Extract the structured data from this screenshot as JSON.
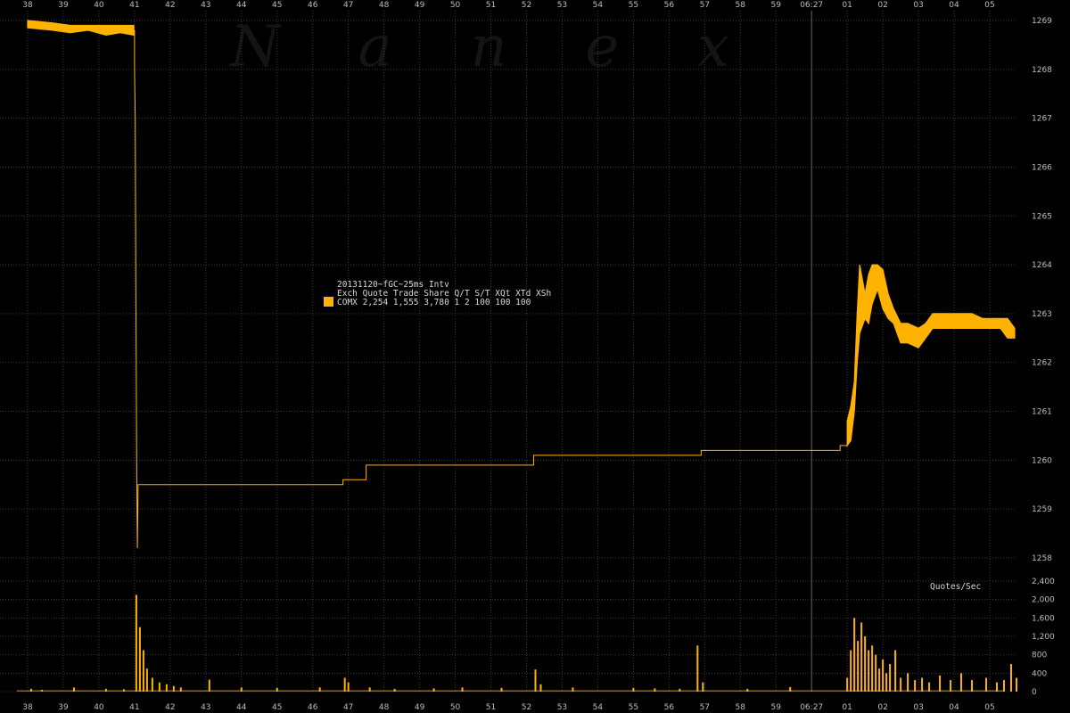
{
  "chart_data": [
    {
      "type": "line",
      "title": "",
      "xlabel": "",
      "ylabel": "",
      "watermark": "N a n e x",
      "grid": true,
      "colors": {
        "background": "#000000",
        "series": "#ffb300",
        "grid": "#3a3a3a",
        "marker_line": "#666666"
      },
      "x_ticks": [
        "38",
        "39",
        "40",
        "41",
        "42",
        "43",
        "44",
        "45",
        "46",
        "47",
        "48",
        "49",
        "50",
        "51",
        "52",
        "53",
        "54",
        "55",
        "56",
        "57",
        "58",
        "59",
        "06:27",
        "01",
        "02",
        "03",
        "04",
        "05"
      ],
      "y_ticks": [
        "1269",
        "1268",
        "1267",
        "1266",
        "1265",
        "1264",
        "1263",
        "1262",
        "1261",
        "1260",
        "1259",
        "1258"
      ],
      "ylim": [
        1257.8,
        1269.2
      ],
      "time_marker": "06:27",
      "legend": {
        "title": "20131120~fGC~25ms Intv",
        "header": "Exch Quote Trade Share  Q/T   S/T  XQt XTd XSh",
        "row": "COMX 2,254 1,555 3,780    1     2 100 100 100"
      },
      "series": [
        {
          "style": "band",
          "points": [
            [
              38.0,
              1268.85,
              1269.0
            ],
            [
              38.7,
              1268.8,
              1268.95
            ],
            [
              39.2,
              1268.75,
              1268.9
            ],
            [
              39.7,
              1268.8,
              1268.9
            ],
            [
              40.2,
              1268.7,
              1268.9
            ],
            [
              40.6,
              1268.75,
              1268.9
            ],
            [
              40.98,
              1268.7,
              1268.9
            ]
          ]
        },
        {
          "style": "line",
          "points": [
            [
              41.0,
              1268.8
            ],
            [
              41.0,
              1268.0
            ],
            [
              41.02,
              1267.0
            ],
            [
              41.03,
              1265.0
            ],
            [
              41.04,
              1263.0
            ],
            [
              41.05,
              1261.6
            ],
            [
              41.06,
              1260.0
            ],
            [
              41.07,
              1259.0
            ],
            [
              41.08,
              1258.2
            ],
            [
              41.1,
              1259.5
            ],
            [
              46.85,
              1259.5
            ],
            [
              46.85,
              1259.6
            ],
            [
              47.5,
              1259.6
            ],
            [
              47.5,
              1259.9
            ],
            [
              52.2,
              1259.9
            ],
            [
              52.2,
              1260.1
            ],
            [
              56.9,
              1260.1
            ],
            [
              56.9,
              1260.2
            ],
            [
              60.8,
              1260.2
            ],
            [
              60.8,
              1260.3
            ],
            [
              61.0,
              1260.3
            ]
          ]
        },
        {
          "style": "band",
          "points": [
            [
              61.0,
              1260.3,
              1260.8
            ],
            [
              61.1,
              1260.4,
              1261.1
            ],
            [
              61.2,
              1261.0,
              1261.6
            ],
            [
              61.28,
              1262.0,
              1263.0
            ],
            [
              61.35,
              1262.6,
              1264.0
            ],
            [
              61.5,
              1262.9,
              1263.4
            ],
            [
              61.6,
              1262.8,
              1263.8
            ],
            [
              61.7,
              1263.2,
              1264.0
            ],
            [
              61.85,
              1263.5,
              1264.0
            ],
            [
              62.0,
              1263.1,
              1263.9
            ],
            [
              62.15,
              1262.9,
              1263.4
            ],
            [
              62.3,
              1262.8,
              1263.1
            ],
            [
              62.5,
              1262.4,
              1262.8
            ],
            [
              62.7,
              1262.4,
              1262.8
            ],
            [
              63.0,
              1262.3,
              1262.7
            ],
            [
              63.2,
              1262.5,
              1262.8
            ],
            [
              63.4,
              1262.7,
              1263.0
            ],
            [
              63.8,
              1262.7,
              1263.0
            ],
            [
              64.2,
              1262.7,
              1263.0
            ],
            [
              64.5,
              1262.7,
              1263.0
            ],
            [
              64.8,
              1262.7,
              1262.9
            ],
            [
              65.3,
              1262.7,
              1262.9
            ],
            [
              65.5,
              1262.5,
              1262.9
            ],
            [
              65.7,
              1262.5,
              1262.7
            ]
          ]
        }
      ]
    },
    {
      "type": "bar",
      "title": "Quotes/Sec",
      "y_ticks": [
        "2,400",
        "2,000",
        "1,600",
        "1,200",
        "800",
        "400",
        "0"
      ],
      "ylim": [
        0,
        2400
      ],
      "x_range": [
        38,
        65.9
      ],
      "quiet_level": 30,
      "bars": [
        [
          38.1,
          60
        ],
        [
          38.4,
          40
        ],
        [
          39.3,
          90
        ],
        [
          40.2,
          60
        ],
        [
          40.7,
          50
        ],
        [
          41.05,
          2100
        ],
        [
          41.15,
          1400
        ],
        [
          41.25,
          900
        ],
        [
          41.35,
          500
        ],
        [
          41.5,
          300
        ],
        [
          41.7,
          200
        ],
        [
          41.9,
          160
        ],
        [
          42.1,
          120
        ],
        [
          42.3,
          90
        ],
        [
          43.1,
          260
        ],
        [
          44.0,
          90
        ],
        [
          45.0,
          80
        ],
        [
          46.2,
          90
        ],
        [
          46.9,
          300
        ],
        [
          47.0,
          200
        ],
        [
          47.6,
          90
        ],
        [
          48.3,
          60
        ],
        [
          49.4,
          70
        ],
        [
          50.2,
          90
        ],
        [
          51.3,
          80
        ],
        [
          52.25,
          480
        ],
        [
          52.4,
          160
        ],
        [
          53.3,
          90
        ],
        [
          55.0,
          80
        ],
        [
          55.6,
          70
        ],
        [
          56.3,
          60
        ],
        [
          56.8,
          1000
        ],
        [
          56.95,
          200
        ],
        [
          58.2,
          60
        ],
        [
          59.4,
          100
        ],
        [
          61.0,
          300
        ],
        [
          61.1,
          900
        ],
        [
          61.2,
          1600
        ],
        [
          61.3,
          1100
        ],
        [
          61.4,
          1500
        ],
        [
          61.5,
          1200
        ],
        [
          61.6,
          900
        ],
        [
          61.7,
          1000
        ],
        [
          61.8,
          800
        ],
        [
          61.9,
          500
        ],
        [
          62.0,
          700
        ],
        [
          62.1,
          400
        ],
        [
          62.2,
          600
        ],
        [
          62.35,
          900
        ],
        [
          62.5,
          300
        ],
        [
          62.7,
          400
        ],
        [
          62.9,
          250
        ],
        [
          63.1,
          300
        ],
        [
          63.3,
          200
        ],
        [
          63.6,
          350
        ],
        [
          63.9,
          250
        ],
        [
          64.2,
          400
        ],
        [
          64.5,
          250
        ],
        [
          64.9,
          300
        ],
        [
          65.2,
          200
        ],
        [
          65.4,
          250
        ],
        [
          65.6,
          600
        ],
        [
          65.75,
          300
        ]
      ]
    }
  ]
}
